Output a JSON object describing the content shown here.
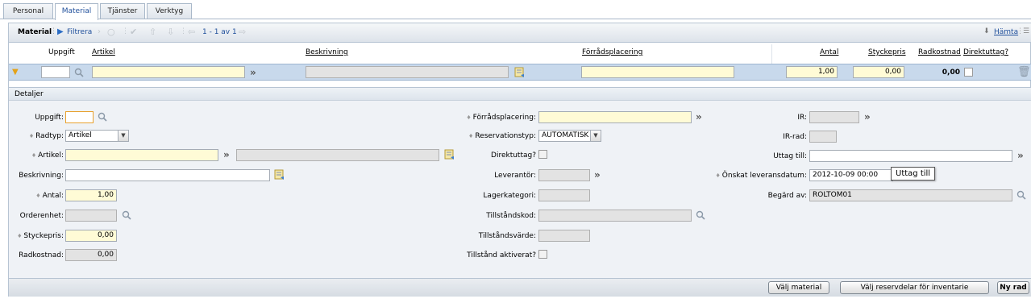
{
  "tabs": [
    {
      "label": "Personal",
      "active": false
    },
    {
      "label": "Material",
      "active": true
    },
    {
      "label": "Tjänster",
      "active": false
    },
    {
      "label": "Verktyg",
      "active": false
    }
  ],
  "toolbar": {
    "title": "Material",
    "filter_label": "Filtrera",
    "record_count": "1 - 1 av 1",
    "fetch_label": "Hämta"
  },
  "table": {
    "headers": {
      "uppgift": "Uppgift",
      "artikel": "Artikel",
      "beskrivning": "Beskrivning",
      "forradsplacering": "Förrådsplacering",
      "antal": "Antal",
      "styckepris": "Styckepris",
      "radkostnad": "Radkostnad",
      "direktuttag": "Direktuttag?"
    },
    "row": {
      "uppgift": "",
      "artikel": "",
      "beskrivning": "",
      "forradsplacering": "",
      "antal": "1,00",
      "styckepris": "0,00",
      "radkostnad": "0,00"
    }
  },
  "details": {
    "title": "Detaljer",
    "left": {
      "uppgift_label": "Uppgift:",
      "uppgift_value": "",
      "radtyp_label": "Radtyp:",
      "radtyp_value": "Artikel",
      "artikel_label": "Artikel:",
      "artikel_value": "",
      "artikel_desc": "",
      "beskrivning_label": "Beskrivning:",
      "beskrivning_value": "",
      "antal_label": "Antal:",
      "antal_value": "1,00",
      "orderenhet_label": "Orderenhet:",
      "orderenhet_value": "",
      "styckepris_label": "Styckepris:",
      "styckepris_value": "0,00",
      "radkostnad_label": "Radkostnad:",
      "radkostnad_value": "0,00"
    },
    "middle": {
      "forradsplacering_label": "Förrådsplacering:",
      "forradsplacering_value": "",
      "reservationstyp_label": "Reservationstyp:",
      "reservationstyp_value": "AUTOMATISK",
      "direktuttag_label": "Direktuttag?",
      "leverantor_label": "Leverantör:",
      "leverantor_value": "",
      "lagerkategori_label": "Lagerkategori:",
      "lagerkategori_value": "",
      "tillstandskod_label": "Tillståndskod:",
      "tillstandskod_value": "",
      "tillstandsvarde_label": "Tillståndsvärde:",
      "tillstandsvarde_value": "",
      "tillstand_aktiverat_label": "Tillstånd aktiverat?"
    },
    "right": {
      "ir_label": "IR:",
      "ir_value": "",
      "irrad_label": "IR-rad:",
      "irrad_value": "",
      "uttag_till_label": "Uttag till:",
      "uttag_till_value": "",
      "onskat_label": "Önskat leveransdatum:",
      "onskat_value": "2012-10-09 00:00",
      "tooltip": "Uttag till",
      "begard_label": "Begärd av:",
      "begard_value": "ROLTOM01"
    }
  },
  "footer": {
    "valj_material": "Välj material",
    "valj_reservdelar": "Välj reservdelar för inventarie",
    "ny_rad": "Ny rad"
  },
  "colors": {
    "selected_row": "#c8d9ec",
    "required_field": "#fffbd6",
    "link_blue": "#1f4f9b"
  }
}
